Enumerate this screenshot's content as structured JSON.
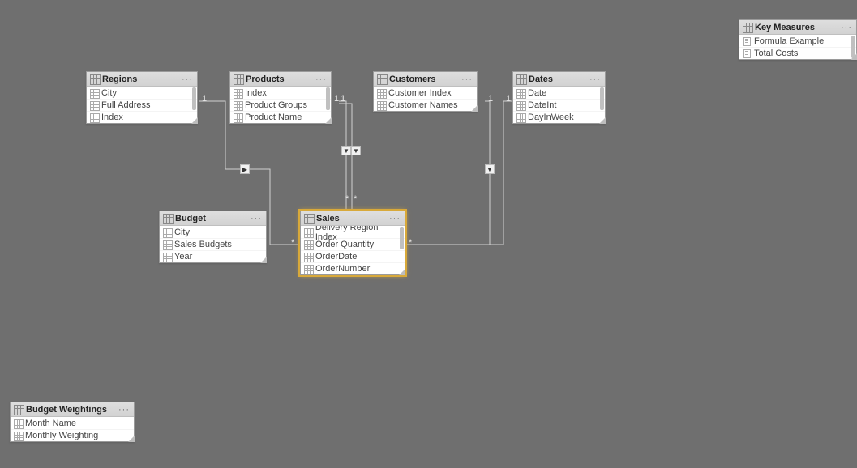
{
  "tables": {
    "regions": {
      "title": "Regions",
      "columns": [
        "City",
        "Full Address",
        "Index"
      ]
    },
    "products": {
      "title": "Products",
      "columns": [
        "Index",
        "Product Groups",
        "Product Name"
      ]
    },
    "customers": {
      "title": "Customers",
      "columns": [
        "Customer Index",
        "Customer Names"
      ]
    },
    "dates": {
      "title": "Dates",
      "columns": [
        "Date",
        "DateInt",
        "DayInWeek"
      ]
    },
    "budget": {
      "title": "Budget",
      "columns": [
        "City",
        "Sales Budgets",
        "Year"
      ]
    },
    "sales": {
      "title": "Sales",
      "columns": [
        "Delivery Region Index",
        "Order Quantity",
        "OrderDate",
        "OrderNumber"
      ]
    },
    "key_measures": {
      "title": "Key Measures",
      "measures": [
        "Formula Example",
        "Total Costs"
      ]
    },
    "budget_weightings": {
      "title": "Budget Weightings",
      "columns": [
        "Month Name",
        "Monthly Weighting"
      ]
    }
  },
  "cardinality": {
    "one": "1",
    "many": "*"
  },
  "more_menu": "···"
}
